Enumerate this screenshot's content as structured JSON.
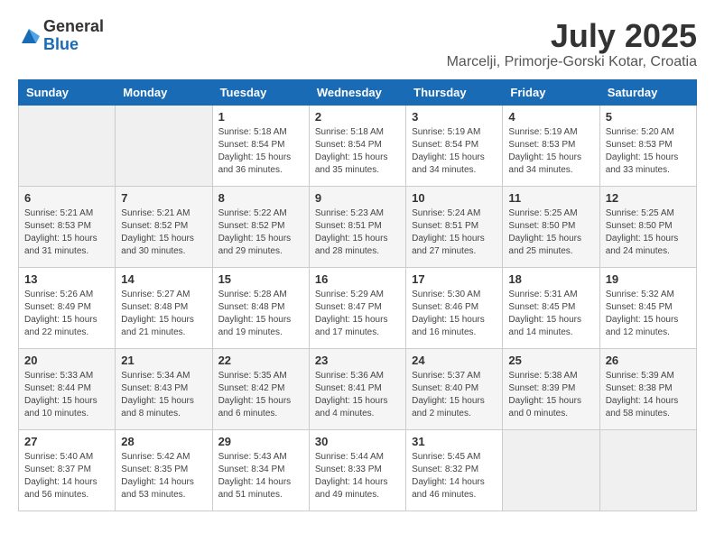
{
  "logo": {
    "general": "General",
    "blue": "Blue"
  },
  "title": "July 2025",
  "location": "Marcelji, Primorje-Gorski Kotar, Croatia",
  "days_of_week": [
    "Sunday",
    "Monday",
    "Tuesday",
    "Wednesday",
    "Thursday",
    "Friday",
    "Saturday"
  ],
  "weeks": [
    [
      {
        "day": "",
        "info": ""
      },
      {
        "day": "",
        "info": ""
      },
      {
        "day": "1",
        "info": "Sunrise: 5:18 AM\nSunset: 8:54 PM\nDaylight: 15 hours and 36 minutes."
      },
      {
        "day": "2",
        "info": "Sunrise: 5:18 AM\nSunset: 8:54 PM\nDaylight: 15 hours and 35 minutes."
      },
      {
        "day": "3",
        "info": "Sunrise: 5:19 AM\nSunset: 8:54 PM\nDaylight: 15 hours and 34 minutes."
      },
      {
        "day": "4",
        "info": "Sunrise: 5:19 AM\nSunset: 8:53 PM\nDaylight: 15 hours and 34 minutes."
      },
      {
        "day": "5",
        "info": "Sunrise: 5:20 AM\nSunset: 8:53 PM\nDaylight: 15 hours and 33 minutes."
      }
    ],
    [
      {
        "day": "6",
        "info": "Sunrise: 5:21 AM\nSunset: 8:53 PM\nDaylight: 15 hours and 31 minutes."
      },
      {
        "day": "7",
        "info": "Sunrise: 5:21 AM\nSunset: 8:52 PM\nDaylight: 15 hours and 30 minutes."
      },
      {
        "day": "8",
        "info": "Sunrise: 5:22 AM\nSunset: 8:52 PM\nDaylight: 15 hours and 29 minutes."
      },
      {
        "day": "9",
        "info": "Sunrise: 5:23 AM\nSunset: 8:51 PM\nDaylight: 15 hours and 28 minutes."
      },
      {
        "day": "10",
        "info": "Sunrise: 5:24 AM\nSunset: 8:51 PM\nDaylight: 15 hours and 27 minutes."
      },
      {
        "day": "11",
        "info": "Sunrise: 5:25 AM\nSunset: 8:50 PM\nDaylight: 15 hours and 25 minutes."
      },
      {
        "day": "12",
        "info": "Sunrise: 5:25 AM\nSunset: 8:50 PM\nDaylight: 15 hours and 24 minutes."
      }
    ],
    [
      {
        "day": "13",
        "info": "Sunrise: 5:26 AM\nSunset: 8:49 PM\nDaylight: 15 hours and 22 minutes."
      },
      {
        "day": "14",
        "info": "Sunrise: 5:27 AM\nSunset: 8:48 PM\nDaylight: 15 hours and 21 minutes."
      },
      {
        "day": "15",
        "info": "Sunrise: 5:28 AM\nSunset: 8:48 PM\nDaylight: 15 hours and 19 minutes."
      },
      {
        "day": "16",
        "info": "Sunrise: 5:29 AM\nSunset: 8:47 PM\nDaylight: 15 hours and 17 minutes."
      },
      {
        "day": "17",
        "info": "Sunrise: 5:30 AM\nSunset: 8:46 PM\nDaylight: 15 hours and 16 minutes."
      },
      {
        "day": "18",
        "info": "Sunrise: 5:31 AM\nSunset: 8:45 PM\nDaylight: 15 hours and 14 minutes."
      },
      {
        "day": "19",
        "info": "Sunrise: 5:32 AM\nSunset: 8:45 PM\nDaylight: 15 hours and 12 minutes."
      }
    ],
    [
      {
        "day": "20",
        "info": "Sunrise: 5:33 AM\nSunset: 8:44 PM\nDaylight: 15 hours and 10 minutes."
      },
      {
        "day": "21",
        "info": "Sunrise: 5:34 AM\nSunset: 8:43 PM\nDaylight: 15 hours and 8 minutes."
      },
      {
        "day": "22",
        "info": "Sunrise: 5:35 AM\nSunset: 8:42 PM\nDaylight: 15 hours and 6 minutes."
      },
      {
        "day": "23",
        "info": "Sunrise: 5:36 AM\nSunset: 8:41 PM\nDaylight: 15 hours and 4 minutes."
      },
      {
        "day": "24",
        "info": "Sunrise: 5:37 AM\nSunset: 8:40 PM\nDaylight: 15 hours and 2 minutes."
      },
      {
        "day": "25",
        "info": "Sunrise: 5:38 AM\nSunset: 8:39 PM\nDaylight: 15 hours and 0 minutes."
      },
      {
        "day": "26",
        "info": "Sunrise: 5:39 AM\nSunset: 8:38 PM\nDaylight: 14 hours and 58 minutes."
      }
    ],
    [
      {
        "day": "27",
        "info": "Sunrise: 5:40 AM\nSunset: 8:37 PM\nDaylight: 14 hours and 56 minutes."
      },
      {
        "day": "28",
        "info": "Sunrise: 5:42 AM\nSunset: 8:35 PM\nDaylight: 14 hours and 53 minutes."
      },
      {
        "day": "29",
        "info": "Sunrise: 5:43 AM\nSunset: 8:34 PM\nDaylight: 14 hours and 51 minutes."
      },
      {
        "day": "30",
        "info": "Sunrise: 5:44 AM\nSunset: 8:33 PM\nDaylight: 14 hours and 49 minutes."
      },
      {
        "day": "31",
        "info": "Sunrise: 5:45 AM\nSunset: 8:32 PM\nDaylight: 14 hours and 46 minutes."
      },
      {
        "day": "",
        "info": ""
      },
      {
        "day": "",
        "info": ""
      }
    ]
  ]
}
